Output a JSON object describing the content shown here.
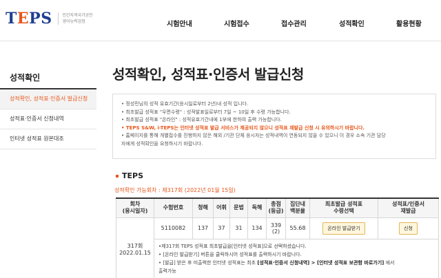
{
  "logo": {
    "word_start": "T",
    "word_e": "E",
    "word_end": "PS",
    "sub1": "민간자격국가공인",
    "sub2": "영어능력검정"
  },
  "nav": [
    "시험안내",
    "시험접수",
    "접수관리",
    "성적확인",
    "활용현황"
  ],
  "sidebar": {
    "title": "성적확인",
    "items": [
      {
        "label": "성적확인, 성적표·인증서 발급신청",
        "active": true
      },
      {
        "label": "성적표·인증서 신청내역",
        "active": false
      },
      {
        "label": "인터넷 성적표 원본대조",
        "active": false
      }
    ]
  },
  "page_title": "성적확인, 성적표·인증서 발급신청",
  "notice": [
    "• 정성민님의 성적 유효기간(응시일로부터 2년)내 성적 입니다.",
    "• 최초발급 성적표 \"우편수령\" : 성적발표일로부터 7일 ~ 10일 후 수령 가능합니다.",
    "• 최초발급 성적표 \"온라인\" : 성적유효기간내에 1부에 한하여 출력 가능합니다.",
    "• TEPS S&W, i-TEPS는 인터넷 성적표 발급 서비스가 제공되지 않으니 성적표 재발급 신청 시 유의하시기 바랍니다.",
    "• 홈페이지를 통해 개별접수를 진행하지 않은 해외 /기관 단체 응시자는 성적내역이 연동되지 않을 수 있으니 이 경우 소속 기관 담당",
    "  자에게 성적확인을 요청하시기 바랍니다."
  ],
  "section": {
    "title": "TEPS",
    "available": "성적확인 가능회차 : 제317회 (2022년 01월 15일)"
  },
  "table": {
    "headers": {
      "round": [
        "회차",
        "(응시일자)"
      ],
      "exam_no": "수험번호",
      "listening": "청해",
      "vocab": "어휘",
      "grammar": "문법",
      "reading": "독해",
      "total": [
        "총점",
        "(등급)"
      ],
      "percentile": [
        "집단내",
        "백분율"
      ],
      "first_issue": [
        "최초발급 성적표",
        "수령선택"
      ],
      "reissue": [
        "성적표/인증서",
        "재발급"
      ]
    },
    "row": {
      "round": "317회",
      "date": "2022.01.15",
      "exam_no": "5110082",
      "listening": "137",
      "vocab": "37",
      "grammar": "31",
      "reading": "134",
      "total": "339",
      "grade": "(2)",
      "percentile": "55.68",
      "online_button": "온라인 발급받기",
      "apply_button": "신청"
    },
    "info": {
      "line1": "•제317회 TEPS 성적표 최초발급을[인터넷 성적표]으로 선택하셨습니다.",
      "line2": "• [온라인 발급받기] 버튼을 클릭하시어 성적표를 출력하시기 바랍니다.",
      "line3_pre": "• [발급] 받은 후 미출력한 인터넷 성적표는 최초 ",
      "line3_bold": "[성적표·인증서 신청내역] > [인터넷 성적표 보관함 바로가기]",
      "line3_post": " 에서",
      "line4": "출력가능"
    }
  }
}
